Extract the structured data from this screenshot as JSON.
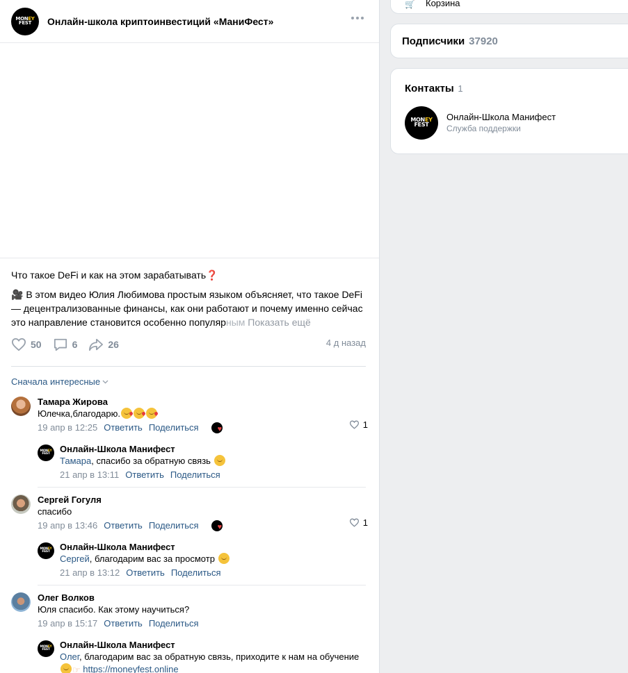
{
  "post": {
    "group_name": "Онлайн-школа криптоинвестиций «МаниФест»",
    "title": "Что такое DeFi и как на этом зарабатывать❓",
    "text_icon": "🎥",
    "text_main": " В этом видео Юлия Любимова простым языком объясняет, что такое DeFi — децентрализованные финансы, как они работают и почему именно сейчас это направление становится особенно популяр",
    "text_fade": "ным",
    "show_more": "Показать ещё",
    "likes": "50",
    "comments_count": "6",
    "shares": "26",
    "time": "4 д назад"
  },
  "logo": {
    "line1": "MON",
    "line1_y": "EY",
    "line2": "FEST"
  },
  "sort_label": "Сначала интересные",
  "comments": [
    {
      "author": "Тамара Жирова",
      "text": "Юлечка,благодарю.",
      "date": "19 апр в 12:25",
      "reply_label": "Ответить",
      "share_label": "Поделиться",
      "likes": "1",
      "reply": {
        "author": "Онлайн-Школа Манифест",
        "mention": "Тамара",
        "text": ", спасибо за обратную связь ",
        "date": "21 апр в 13:11",
        "reply_label": "Ответить",
        "share_label": "Поделиться"
      }
    },
    {
      "author": "Сергей Гогуля",
      "text": "спасибо",
      "date": "19 апр в 13:46",
      "reply_label": "Ответить",
      "share_label": "Поделиться",
      "likes": "1",
      "reply": {
        "author": "Онлайн-Школа Манифест",
        "mention": "Сергей",
        "text": ", благодарим вас за просмотр ",
        "date": "21 апр в 13:12",
        "reply_label": "Ответить",
        "share_label": "Поделиться"
      }
    },
    {
      "author": "Олег Волков",
      "text": "Юля спасибо. Как этому научиться?",
      "date": "19 апр в 15:17",
      "reply_label": "Ответить",
      "share_label": "Поделиться",
      "reply": {
        "author": "Онлайн-Школа Манифест",
        "mention": "Олег",
        "text": ", благодарим вас за обратную связь, приходите к нам на обучение ",
        "link": "https://moneyfest.online"
      }
    }
  ],
  "sidebar": {
    "top_label": "Корзина",
    "subscribers_label": "Подписчики",
    "subscribers_count": "37920",
    "contacts_label": "Контакты",
    "contacts_count": "1",
    "contact_name": "Онлайн-Школа Манифест",
    "contact_role": "Служба поддержки"
  },
  "colors": {
    "link": "#2a5885",
    "muted": "#818c99",
    "background": "#edeef0",
    "like_heart": "#e64646"
  },
  "icons": [
    "more-icon",
    "heart-icon",
    "comment-icon",
    "share-icon",
    "chevron-down-icon",
    "cart-icon"
  ]
}
